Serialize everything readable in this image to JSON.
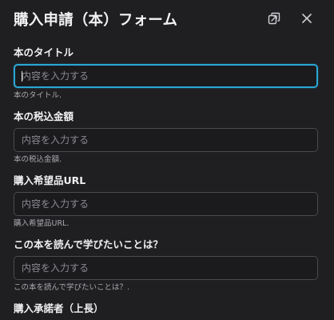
{
  "dialog": {
    "title": "購入申請（本）フォーム",
    "popout_icon": "popout-icon",
    "close_icon": "close-icon"
  },
  "fields": [
    {
      "label": "本のタイトル",
      "placeholder": "内容を入力する",
      "value": "",
      "help": "本のタイトル."
    },
    {
      "label": "本の税込金額",
      "placeholder": "内容を入力する",
      "value": "",
      "help": "本の税込金額."
    },
    {
      "label": "購入希望品URL",
      "placeholder": "内容を入力する",
      "value": "",
      "help": "購入希望品URL."
    },
    {
      "label": "この本を読んで学びたいことは？",
      "placeholder": "内容を入力する",
      "value": "",
      "help": "この本を読んで学びたいことは？."
    },
    {
      "label": "購入承諾者（上長）"
    }
  ],
  "colors": {
    "background": "#1f1f22",
    "focus_border": "#2aa7d6",
    "input_border": "#4a4a50"
  }
}
